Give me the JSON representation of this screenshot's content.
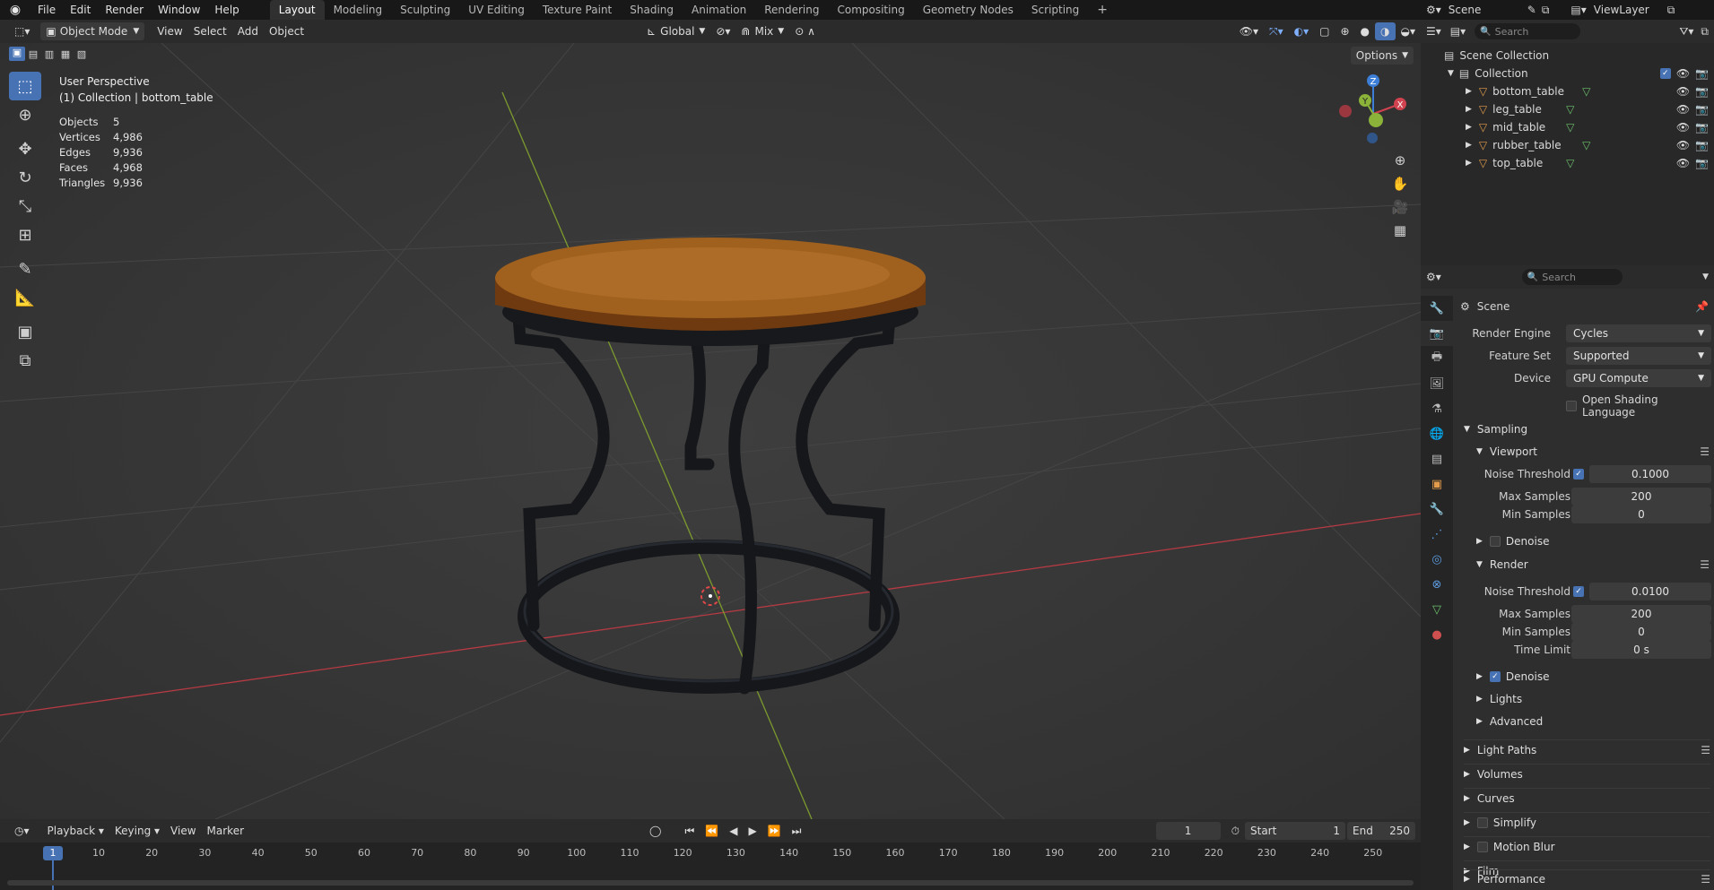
{
  "topbar": {
    "menus": [
      "File",
      "Edit",
      "Render",
      "Window",
      "Help"
    ],
    "workspaces": [
      "Layout",
      "Modeling",
      "Sculpting",
      "UV Editing",
      "Texture Paint",
      "Shading",
      "Animation",
      "Rendering",
      "Compositing",
      "Geometry Nodes",
      "Scripting"
    ],
    "active_workspace": "Layout",
    "scene_name": "Scene",
    "view_layer": "ViewLayer"
  },
  "viewport_header": {
    "mode": "Object Mode",
    "menus": [
      "View",
      "Select",
      "Add",
      "Object"
    ],
    "orientation": "Global",
    "snap_mode": "Mix",
    "options": "Options"
  },
  "overlay": {
    "perspective": "User Perspective",
    "collection": "(1) Collection | bottom_table",
    "stats": [
      {
        "label": "Objects",
        "value": "5"
      },
      {
        "label": "Vertices",
        "value": "4,986"
      },
      {
        "label": "Edges",
        "value": "9,936"
      },
      {
        "label": "Faces",
        "value": "4,968"
      },
      {
        "label": "Triangles",
        "value": "9,936"
      }
    ]
  },
  "gizmo": {
    "x": "X",
    "y": "Y",
    "z": "Z"
  },
  "timeline": {
    "menus": [
      "Playback",
      "Keying",
      "View",
      "Marker"
    ],
    "current_frame": "1",
    "start_label": "Start",
    "start": "1",
    "end_label": "End",
    "end": "250",
    "ruler": [
      "1",
      "10",
      "20",
      "30",
      "40",
      "50",
      "60",
      "70",
      "80",
      "90",
      "100",
      "110",
      "120",
      "130",
      "140",
      "150",
      "160",
      "170",
      "180",
      "190",
      "200",
      "210",
      "220",
      "230",
      "240",
      "250"
    ]
  },
  "outliner": {
    "search_placeholder": "Search",
    "scene_collection": "Scene Collection",
    "collection": "Collection",
    "objects": [
      "bottom_table",
      "leg_table",
      "mid_table",
      "rubber_table",
      "top_table"
    ]
  },
  "properties": {
    "search_placeholder": "Search",
    "context": "Scene",
    "render_engine_label": "Render Engine",
    "render_engine": "Cycles",
    "feature_set_label": "Feature Set",
    "feature_set": "Supported",
    "device_label": "Device",
    "device": "GPU Compute",
    "osl_label": "Open Shading Language",
    "sampling": "Sampling",
    "viewport": "Viewport",
    "noise_threshold_label": "Noise Threshold",
    "viewport_noise": "0.1000",
    "max_samples_label": "Max Samples",
    "viewport_max": "200",
    "min_samples_label": "Min Samples",
    "viewport_min": "0",
    "denoise_label": "Denoise",
    "render": "Render",
    "render_noise": "0.0100",
    "render_max": "200",
    "render_min": "0",
    "time_limit_label": "Time Limit",
    "time_limit": "0 s",
    "lights": "Lights",
    "advanced": "Advanced",
    "panels": [
      "Light Paths",
      "Volumes",
      "Curves",
      "Simplify",
      "Motion Blur",
      "Film",
      "Performance"
    ]
  },
  "colors": {
    "accent": "#4772b3",
    "x_axis": "#d0424f",
    "y_axis": "#8bb33a",
    "z_axis": "#3d7fd6",
    "wood": "#9a5a1f"
  }
}
